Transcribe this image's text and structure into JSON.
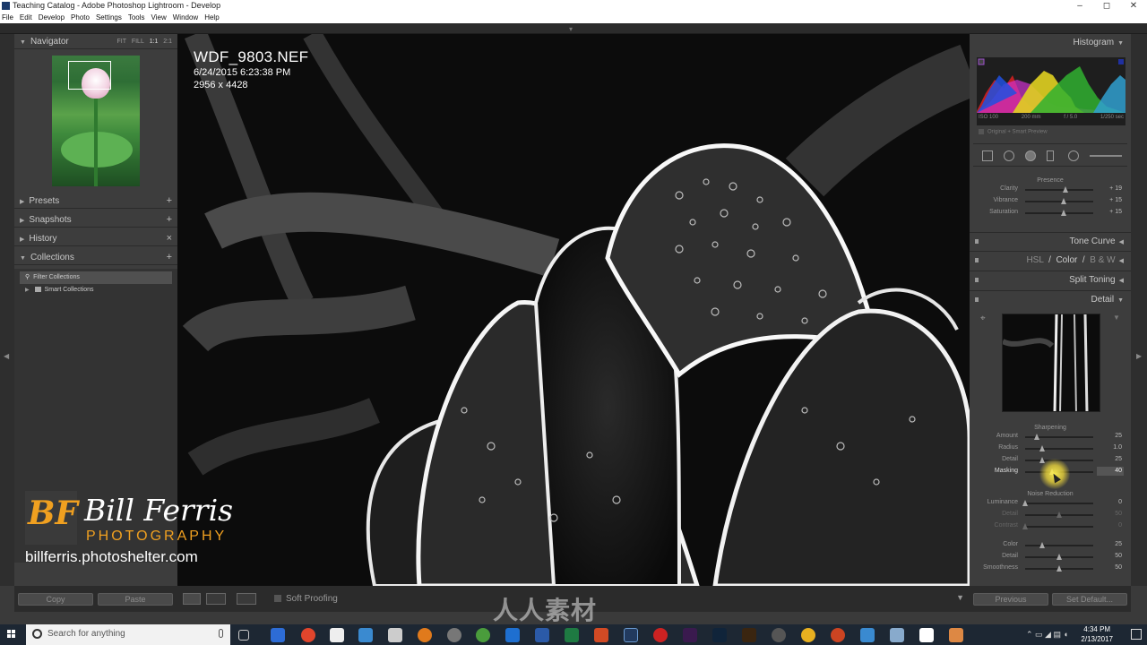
{
  "window": {
    "title": "Teaching Catalog - Adobe Photoshop Lightroom - Develop",
    "controls": [
      "–",
      "◻",
      "✕"
    ]
  },
  "menu": [
    "File",
    "Edit",
    "Develop",
    "Photo",
    "Settings",
    "Tools",
    "View",
    "Window",
    "Help"
  ],
  "left_panel": {
    "navigator": {
      "label": "Navigator",
      "zoom": [
        "FIT",
        "FILL",
        "1:1",
        "2:1"
      ],
      "active_zoom": "1:1"
    },
    "sections": [
      {
        "label": "Presets",
        "action": "+"
      },
      {
        "label": "Snapshots",
        "action": "+"
      },
      {
        "label": "History",
        "action": "×"
      },
      {
        "label": "Collections",
        "action": "+"
      }
    ],
    "collections": {
      "filter": "Filter Collections",
      "items": [
        "Smart Collections"
      ]
    },
    "copy_label": "Copy",
    "paste_label": "Paste"
  },
  "image": {
    "filename": "WDF_9803.NEF",
    "datetime": "6/24/2015 6:23:38 PM",
    "dimensions": "2956 x 4428"
  },
  "branding": {
    "monogram": "BF",
    "name": "Bill Ferris",
    "subtitle": "PHOTOGRAPHY",
    "url": "billferris.photoshelter.com"
  },
  "toolbar": {
    "soft_proofing_label": "Soft Proofing"
  },
  "right_panel": {
    "histogram": {
      "label": "Histogram",
      "iso": "ISO 100",
      "focal": "200 mm",
      "aperture": "f / 5.0",
      "shutter": "1/250 sec",
      "smart_preview": "Original + Smart Preview"
    },
    "presence": {
      "title": "Presence",
      "sliders": [
        {
          "label": "Clarity",
          "value": "+ 19",
          "pos": 0.59
        },
        {
          "label": "Vibrance",
          "value": "+ 15",
          "pos": 0.57
        },
        {
          "label": "Saturation",
          "value": "+ 15",
          "pos": 0.57
        }
      ]
    },
    "sections": {
      "tone_curve": "Tone Curve",
      "hsl": "HSL",
      "color": "Color",
      "bw": "B & W",
      "split_toning": "Split Toning",
      "detail": "Detail"
    },
    "sharpening": {
      "title": "Sharpening",
      "sliders": [
        {
          "label": "Amount",
          "value": "25",
          "pos": 0.17
        },
        {
          "label": "Radius",
          "value": "1.0",
          "pos": 0.25
        },
        {
          "label": "Detail",
          "value": "25",
          "pos": 0.25
        },
        {
          "label": "Masking",
          "value": "40",
          "pos": 0.4
        }
      ]
    },
    "noise_reduction": {
      "title": "Noise Reduction",
      "sliders": [
        {
          "label": "Luminance",
          "value": "0",
          "pos": 0.0
        },
        {
          "label": "Detail",
          "value": "50",
          "pos": 0.5
        },
        {
          "label": "Contrast",
          "value": "0",
          "pos": 0.0
        },
        {
          "label": "Color",
          "value": "25",
          "pos": 0.25
        },
        {
          "label": "Detail",
          "value": "50",
          "pos": 0.5
        },
        {
          "label": "Smoothness",
          "value": "50",
          "pos": 0.5
        }
      ]
    },
    "previous_label": "Previous",
    "set_default_label": "Set Default..."
  },
  "taskbar": {
    "search_placeholder": "Search for anything",
    "time": "4:34 PM",
    "date": "2/13/2017"
  },
  "watermark": "人人素材"
}
